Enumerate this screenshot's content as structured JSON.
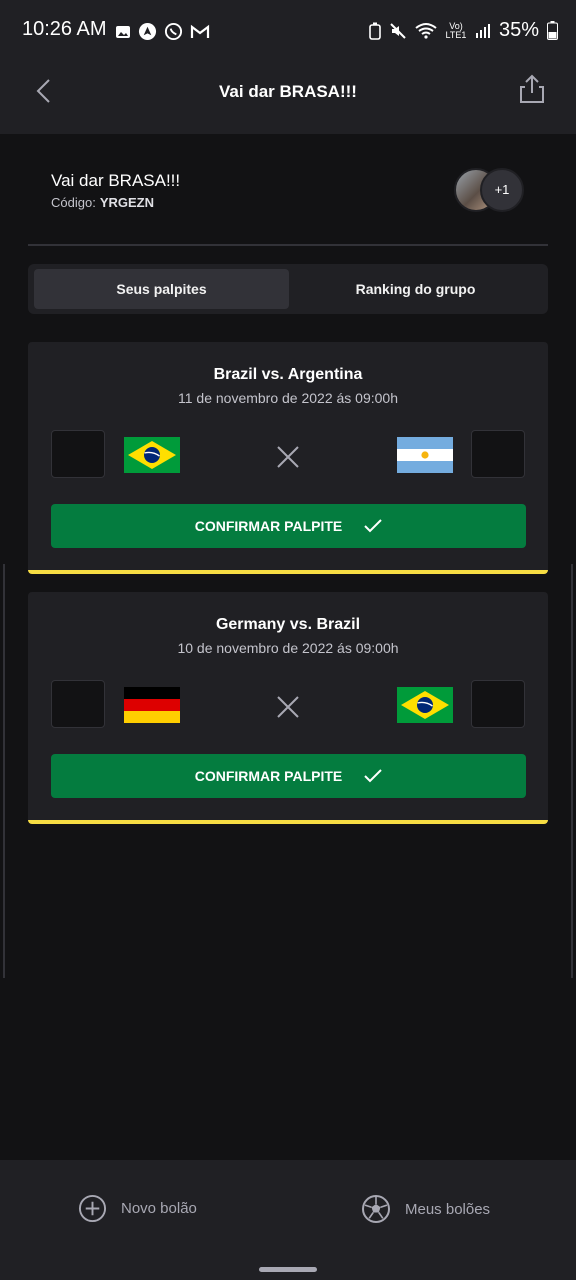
{
  "status_bar": {
    "time": "10:26 AM",
    "battery": "35%",
    "network": "Vo) LTE1",
    "left_icons": [
      "image-icon",
      "arrow-app-icon",
      "whatsapp-icon",
      "gmail-icon"
    ],
    "right_icons": [
      "battery-saver-icon",
      "mute-icon",
      "wifi-icon",
      "lte-icon",
      "signal-icon",
      "battery-icon"
    ]
  },
  "app_bar": {
    "title": "Vai dar BRASA!!!",
    "back_icon": "chevron-left-icon",
    "share_icon": "share-icon"
  },
  "group": {
    "name": "Vai dar BRASA!!!",
    "code_label": "Código:",
    "code_value": "YRGEZN",
    "extra_participants": "+1"
  },
  "tabs": [
    {
      "label": "Seus palpites",
      "active": true
    },
    {
      "label": "Ranking do grupo",
      "active": false
    }
  ],
  "games": [
    {
      "title": "Brazil vs. Argentina",
      "date": "11 de novembro de 2022 ás 09:00h",
      "home_flag": "brazil-flag",
      "away_flag": "argentina-flag",
      "home_score": "",
      "away_score": "",
      "confirm_label": "CONFIRMAR PALPITE"
    },
    {
      "title": "Germany vs. Brazil",
      "date": "10 de novembro de 2022 ás 09:00h",
      "home_flag": "germany-flag",
      "away_flag": "brazil-flag",
      "home_score": "",
      "away_score": "",
      "confirm_label": "CONFIRMAR PALPITE"
    }
  ],
  "bottom_nav": [
    {
      "label": "Novo bolão",
      "icon": "plus-circle-icon"
    },
    {
      "label": "Meus bolões",
      "icon": "soccer-ball-icon"
    }
  ],
  "colors": {
    "background": "#121214",
    "surface": "#202024",
    "accent_green": "#047c3f",
    "accent_yellow": "#f7dd43"
  }
}
